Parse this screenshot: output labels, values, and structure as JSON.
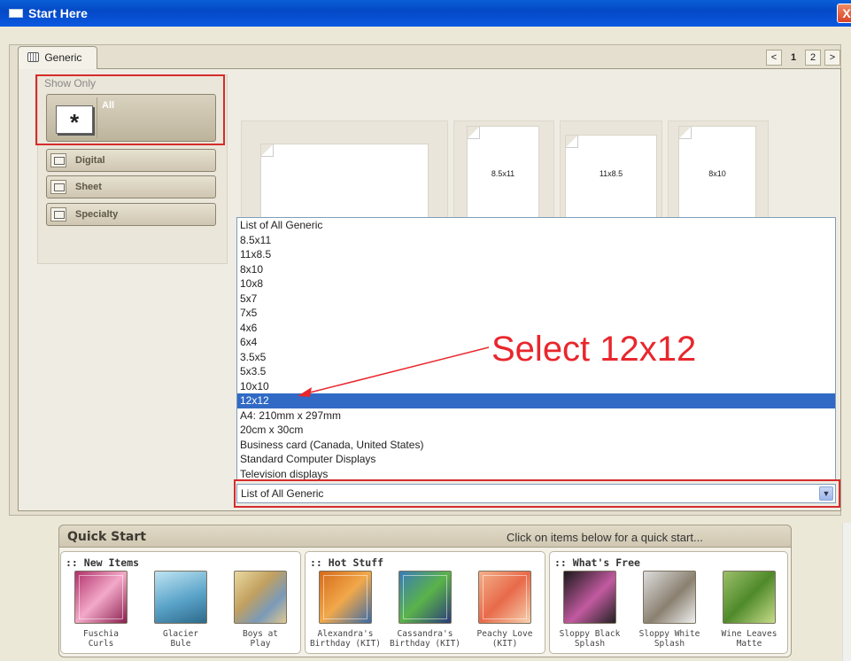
{
  "window": {
    "title": "Start Here",
    "close": "X"
  },
  "tab": {
    "label": "Generic"
  },
  "pager": {
    "prev": "<",
    "pages": [
      "1",
      "2"
    ],
    "next": ">"
  },
  "show_only": {
    "title": "Show Only",
    "all_label": "All",
    "all_icon": "*",
    "categories": [
      "Digital",
      "Sheet",
      "Specialty"
    ]
  },
  "previews": [
    "8.5x11",
    "11x8.5",
    "8x10"
  ],
  "size_list": {
    "options": [
      "List of All Generic",
      "8.5x11",
      "11x8.5",
      "8x10",
      "10x8",
      "5x7",
      "7x5",
      "4x6",
      "6x4",
      "3.5x5",
      "5x3.5",
      "10x10",
      "12x12",
      "A4: 210mm x 297mm",
      "20cm x 30cm",
      "Business card (Canada, United States)",
      "Standard Computer Displays",
      "Television displays"
    ],
    "selected_index": 12,
    "current_value": "List of All Generic"
  },
  "annotation": {
    "text": "Select 12x12",
    "color": "#e8272d"
  },
  "quick_start": {
    "title": "Quick Start",
    "hint": "Click on items below for a quick start...",
    "groups": [
      {
        "title": ":: New Items",
        "items": [
          {
            "line1": "Fuschia",
            "line2": "Curls"
          },
          {
            "line1": "Glacier",
            "line2": "Bule"
          },
          {
            "line1": "Boys at",
            "line2": "Play"
          }
        ]
      },
      {
        "title": ":: Hot Stuff",
        "items": [
          {
            "line1": "Alexandra's",
            "line2": "Birthday (KIT)"
          },
          {
            "line1": "Cassandra's",
            "line2": "Birthday (KIT)"
          },
          {
            "line1": "Peachy Love",
            "line2": "(KIT)"
          }
        ]
      },
      {
        "title": ":: What's Free",
        "items": [
          {
            "line1": "Sloppy Black",
            "line2": "Splash"
          },
          {
            "line1": "Sloppy White",
            "line2": "Splash"
          },
          {
            "line1": "Wine Leaves",
            "line2": "Matte"
          }
        ]
      }
    ]
  },
  "colors": {
    "title_bar": "#0449c6",
    "selection": "#316ac5",
    "highlight_box": "#d62c2c"
  }
}
